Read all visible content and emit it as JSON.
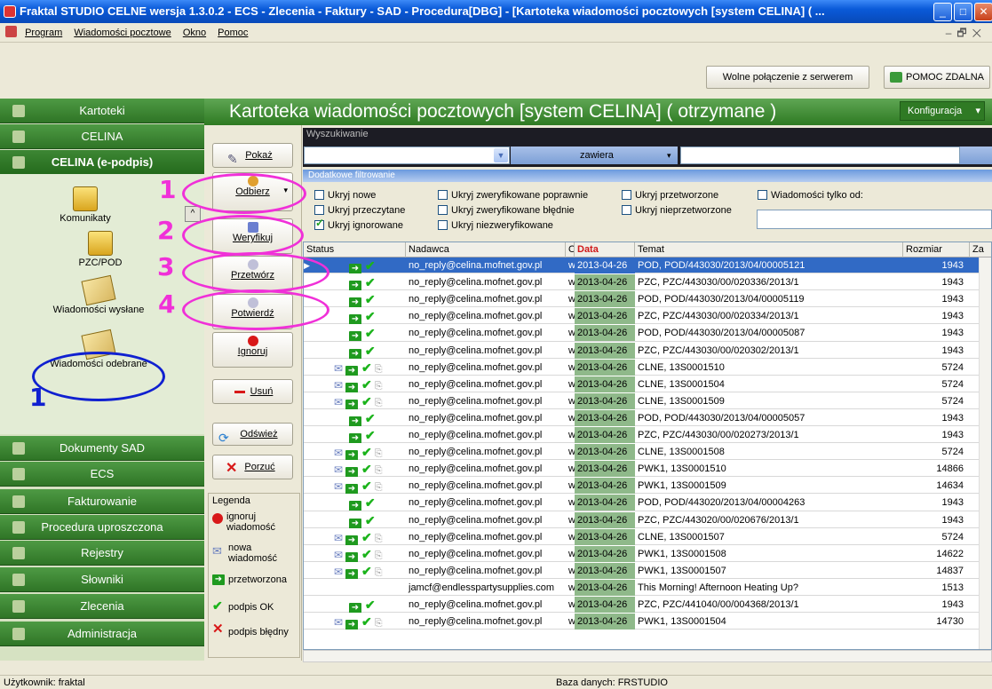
{
  "window": {
    "title": "Fraktal STUDIO CELNE  wersja 1.3.0.2 - ECS - Zlecenia - Faktury - SAD - Procedura[DBG] - [Kartoteka wiadomości pocztowych [system CELINA] ( ...",
    "controls": [
      "_",
      "□",
      "✕"
    ]
  },
  "menu": [
    "Program",
    "Wiadomości pocztowe",
    "Okno",
    "Pomoc"
  ],
  "topbar": {
    "free_connection": "Wolne połączenie z serwerem",
    "remote_help": "POMOC ZDALNA"
  },
  "nav": {
    "items_top": [
      "Kartoteki",
      "CELINA",
      "CELINA (e-podpis)"
    ],
    "panel_items": [
      "Komunikaty",
      "PZC/POD",
      "Wiadomości wysłane",
      "Wiadomości odebrane"
    ],
    "items_bottom": [
      "Dokumenty SAD",
      "ECS",
      "Fakturowanie",
      "Procedura uproszczona",
      "Rejestry",
      "Słowniki",
      "Zlecenia",
      "Administracja"
    ]
  },
  "header": {
    "title": "Kartoteka wiadomości pocztowych [system CELINA] ( otrzymane )",
    "config": "Konfiguracja"
  },
  "actions": [
    "Pokaż",
    "Odbierz",
    "Weryfikuj",
    "Przetwórz",
    "Potwierdź",
    "Ignoruj",
    "Usuń",
    "Odśwież",
    "Porzuć"
  ],
  "search": {
    "label": "Wyszukiwanie",
    "mode": "zawiera"
  },
  "filter": {
    "label": "Dodatkowe filtrowanie",
    "checks": [
      {
        "label": "Ukryj nowe",
        "checked": false
      },
      {
        "label": "Ukryj przeczytane",
        "checked": false
      },
      {
        "label": "Ukryj ignorowane",
        "checked": true
      },
      {
        "label": "Ukryj zweryfikowane poprawnie",
        "checked": false
      },
      {
        "label": "Ukryj zweryfikowane błędnie",
        "checked": false
      },
      {
        "label": "Ukryj niezweryfikowane",
        "checked": false
      },
      {
        "label": "Ukryj przetworzone",
        "checked": false
      },
      {
        "label": "Ukryj nieprzetworzone",
        "checked": false
      },
      {
        "label": "Wiadomości tylko od:",
        "checked": false
      }
    ]
  },
  "table": {
    "columns": [
      "Status",
      "Nadawca",
      "O",
      "Data",
      "Temat",
      "Rozmiar",
      "Za"
    ],
    "rows": [
      {
        "env": false,
        "clip": false,
        "from": "no_reply@celina.mofnet.gov.pl",
        "o": "w",
        "date": "2013-04-26",
        "subject": "POD, POD/443030/2013/04/00005121",
        "size": "1943",
        "selected": true
      },
      {
        "env": false,
        "clip": false,
        "from": "no_reply@celina.mofnet.gov.pl",
        "o": "w",
        "date": "2013-04-26",
        "subject": "PZC, PZC/443030/00/020336/2013/1",
        "size": "1943"
      },
      {
        "env": false,
        "clip": false,
        "from": "no_reply@celina.mofnet.gov.pl",
        "o": "w",
        "date": "2013-04-26",
        "subject": "POD, POD/443030/2013/04/00005119",
        "size": "1943"
      },
      {
        "env": false,
        "clip": false,
        "from": "no_reply@celina.mofnet.gov.pl",
        "o": "w",
        "date": "2013-04-26",
        "subject": "PZC, PZC/443030/00/020334/2013/1",
        "size": "1943"
      },
      {
        "env": false,
        "clip": false,
        "from": "no_reply@celina.mofnet.gov.pl",
        "o": "w",
        "date": "2013-04-26",
        "subject": "POD, POD/443030/2013/04/00005087",
        "size": "1943"
      },
      {
        "env": false,
        "clip": false,
        "from": "no_reply@celina.mofnet.gov.pl",
        "o": "w",
        "date": "2013-04-26",
        "subject": "PZC, PZC/443030/00/020302/2013/1",
        "size": "1943"
      },
      {
        "env": true,
        "clip": true,
        "from": "no_reply@celina.mofnet.gov.pl",
        "o": "w",
        "date": "2013-04-26",
        "subject": "CLNE, 13S0001510",
        "size": "5724"
      },
      {
        "env": true,
        "clip": true,
        "from": "no_reply@celina.mofnet.gov.pl",
        "o": "w",
        "date": "2013-04-26",
        "subject": "CLNE, 13S0001504",
        "size": "5724"
      },
      {
        "env": true,
        "clip": true,
        "from": "no_reply@celina.mofnet.gov.pl",
        "o": "w",
        "date": "2013-04-26",
        "subject": "CLNE, 13S0001509",
        "size": "5724"
      },
      {
        "env": false,
        "clip": false,
        "from": "no_reply@celina.mofnet.gov.pl",
        "o": "w",
        "date": "2013-04-26",
        "subject": "POD, POD/443030/2013/04/00005057",
        "size": "1943"
      },
      {
        "env": false,
        "clip": false,
        "from": "no_reply@celina.mofnet.gov.pl",
        "o": "w",
        "date": "2013-04-26",
        "subject": "PZC, PZC/443030/00/020273/2013/1",
        "size": "1943"
      },
      {
        "env": true,
        "clip": true,
        "from": "no_reply@celina.mofnet.gov.pl",
        "o": "w",
        "date": "2013-04-26",
        "subject": "CLNE, 13S0001508",
        "size": "5724"
      },
      {
        "env": true,
        "clip": true,
        "from": "no_reply@celina.mofnet.gov.pl",
        "o": "w",
        "date": "2013-04-26",
        "subject": "PWK1, 13S0001510",
        "size": "14866"
      },
      {
        "env": true,
        "clip": true,
        "from": "no_reply@celina.mofnet.gov.pl",
        "o": "w",
        "date": "2013-04-26",
        "subject": "PWK1, 13S0001509",
        "size": "14634"
      },
      {
        "env": false,
        "clip": false,
        "from": "no_reply@celina.mofnet.gov.pl",
        "o": "w",
        "date": "2013-04-26",
        "subject": "POD, POD/443020/2013/04/00004263",
        "size": "1943"
      },
      {
        "env": false,
        "clip": false,
        "from": "no_reply@celina.mofnet.gov.pl",
        "o": "w",
        "date": "2013-04-26",
        "subject": "PZC, PZC/443020/00/020676/2013/1",
        "size": "1943"
      },
      {
        "env": true,
        "clip": true,
        "from": "no_reply@celina.mofnet.gov.pl",
        "o": "w",
        "date": "2013-04-26",
        "subject": "CLNE, 13S0001507",
        "size": "5724"
      },
      {
        "env": true,
        "clip": true,
        "from": "no_reply@celina.mofnet.gov.pl",
        "o": "w",
        "date": "2013-04-26",
        "subject": "PWK1, 13S0001508",
        "size": "14622"
      },
      {
        "env": true,
        "clip": true,
        "from": "no_reply@celina.mofnet.gov.pl",
        "o": "w",
        "date": "2013-04-26",
        "subject": "PWK1, 13S0001507",
        "size": "14837"
      },
      {
        "env": false,
        "clip": false,
        "noicons": true,
        "from": "jamcf@endlesspartysupplies.com",
        "o": "w",
        "date": "2013-04-26",
        "subject": "This Morning! Afternoon Heating Up?",
        "size": "1513"
      },
      {
        "env": false,
        "clip": false,
        "from": "no_reply@celina.mofnet.gov.pl",
        "o": "w",
        "date": "2013-04-26",
        "subject": "PZC, PZC/441040/00/004368/2013/1",
        "size": "1943"
      },
      {
        "env": true,
        "clip": true,
        "from": "no_reply@celina.mofnet.gov.pl",
        "o": "w",
        "date": "2013-04-26",
        "subject": "PWK1, 13S0001504",
        "size": "14730"
      }
    ]
  },
  "legend": {
    "title": "Legenda",
    "items": [
      "ignoruj wiadomość",
      "nowa wiadomość",
      "przetworzona",
      "podpis OK",
      "podpis błędny"
    ]
  },
  "annotations": {
    "steps": [
      "1",
      "2",
      "3",
      "4"
    ],
    "nav_step": "1",
    "magenta": "#f030d8",
    "blue": "#1020d0"
  },
  "status": {
    "user": "Użytkownik: fraktal",
    "db": "Baza danych: FRSTUDIO"
  }
}
